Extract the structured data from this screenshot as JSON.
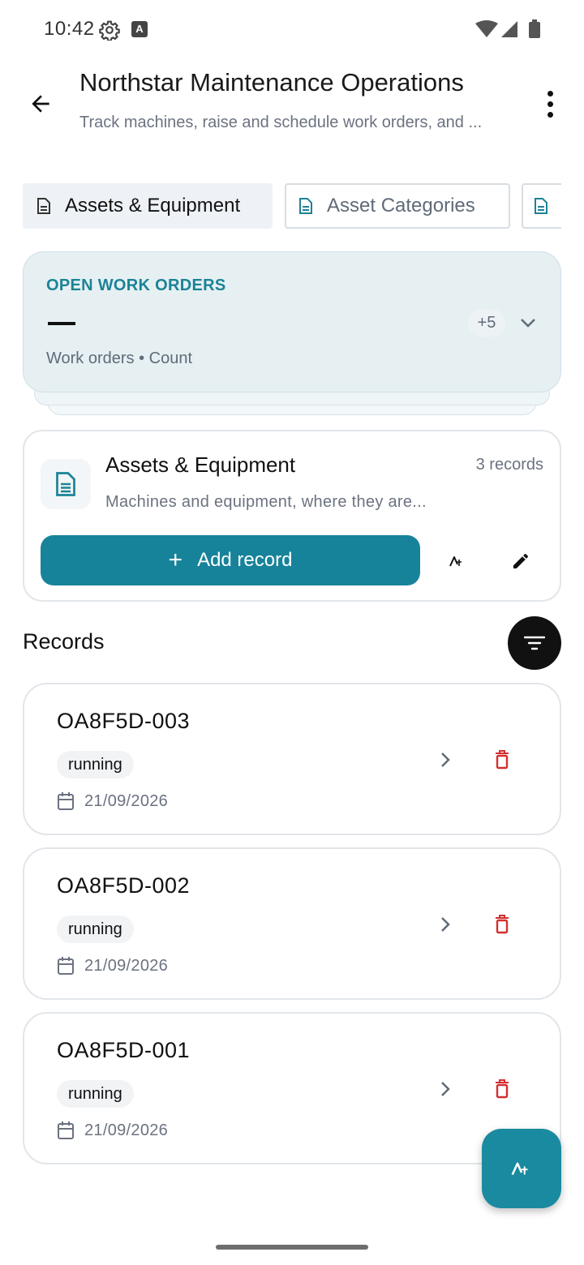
{
  "status_bar": {
    "time": "10:42"
  },
  "header": {
    "title": "Northstar Maintenance Operations",
    "subtitle": "Track machines, raise and schedule work orders, and ..."
  },
  "tabs": [
    {
      "label": "Assets & Equipment",
      "active": true
    },
    {
      "label": "Asset Categories",
      "active": false
    },
    {
      "label": "",
      "active": false
    }
  ],
  "stat_card": {
    "label": "OPEN WORK ORDERS",
    "value": "—",
    "extra_badge": "+5",
    "caption": "Work orders • Count"
  },
  "table_card": {
    "title": "Assets & Equipment",
    "count": "3 records",
    "description": "Machines and equipment, where they are...",
    "add_label": "Add record"
  },
  "records_section": {
    "heading": "Records"
  },
  "records": [
    {
      "id": "OA8F5D-003",
      "status": "running",
      "date": "21/09/2026"
    },
    {
      "id": "OA8F5D-002",
      "status": "running",
      "date": "21/09/2026"
    },
    {
      "id": "OA8F5D-001",
      "status": "running",
      "date": "21/09/2026"
    }
  ],
  "colors": {
    "accent": "#17839a",
    "stat_label": "#1b8396",
    "delete": "#d32f2f",
    "stat_card_bg": "#e6f0f3"
  },
  "icons": {
    "back": "arrow-left-icon",
    "more": "more-vert-icon",
    "tab": "document-icon",
    "expand": "chevron-down-icon",
    "ai": "sparkle-ai-icon",
    "edit": "pencil-icon",
    "filter": "filter-icon",
    "open": "chevron-right-icon",
    "delete": "trash-icon",
    "date": "calendar-icon"
  }
}
